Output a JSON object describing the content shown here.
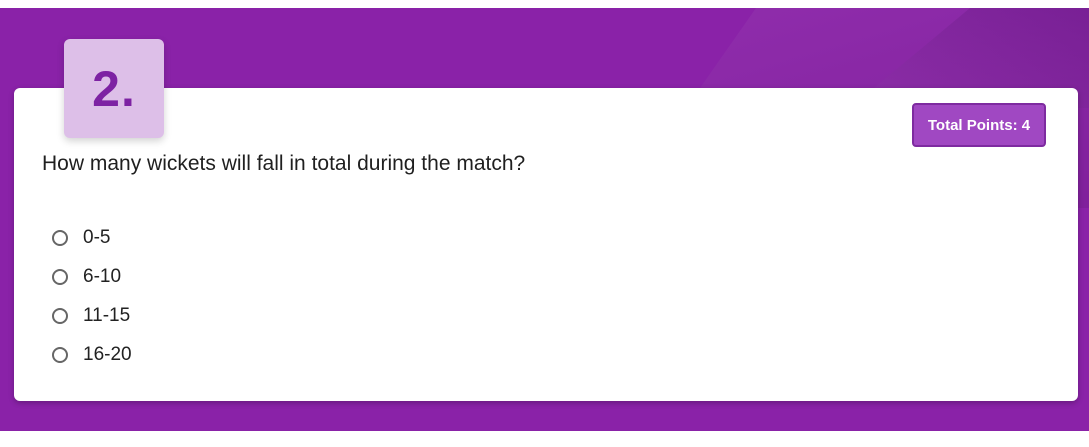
{
  "question": {
    "number": "2.",
    "text": "How many wickets will fall in total during the match?",
    "points_label": "Total Points: 4",
    "options": [
      {
        "label": "0-5"
      },
      {
        "label": "6-10"
      },
      {
        "label": "11-15"
      },
      {
        "label": "16-20"
      }
    ]
  },
  "theme": {
    "background": "#8a22a8",
    "tile": "#ddbfe8",
    "accent": "#7d22a3",
    "badge": "#a048c2"
  },
  "icons": {
    "option_marker": "radio-circle-icon"
  }
}
